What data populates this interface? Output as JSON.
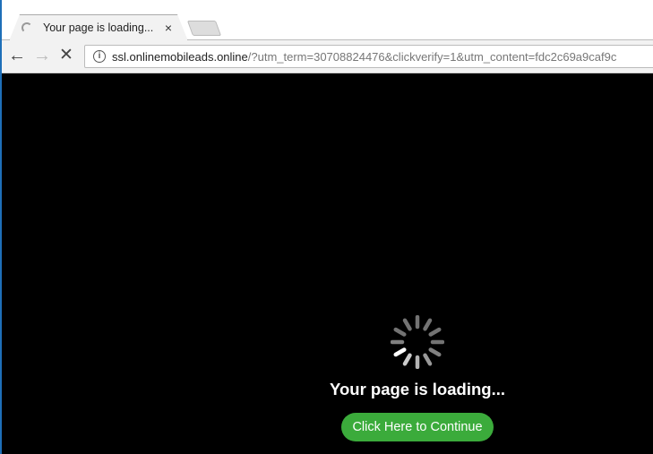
{
  "browser": {
    "tab_title": "Your page is loading...",
    "tab_close": "×",
    "nav": {
      "back": "←",
      "forward": "→",
      "stop": "✕"
    },
    "info_icon": "i",
    "url_host": "ssl.onlinemobileads.online",
    "url_rest": "/?utm_term=30708824476&clickverify=1&utm_content=fdc2c69a9caf9c"
  },
  "page": {
    "loading_text": "Your page is loading...",
    "continue_button": "Click Here to Continue",
    "button_color": "#3bab3b",
    "background": "#000000"
  }
}
